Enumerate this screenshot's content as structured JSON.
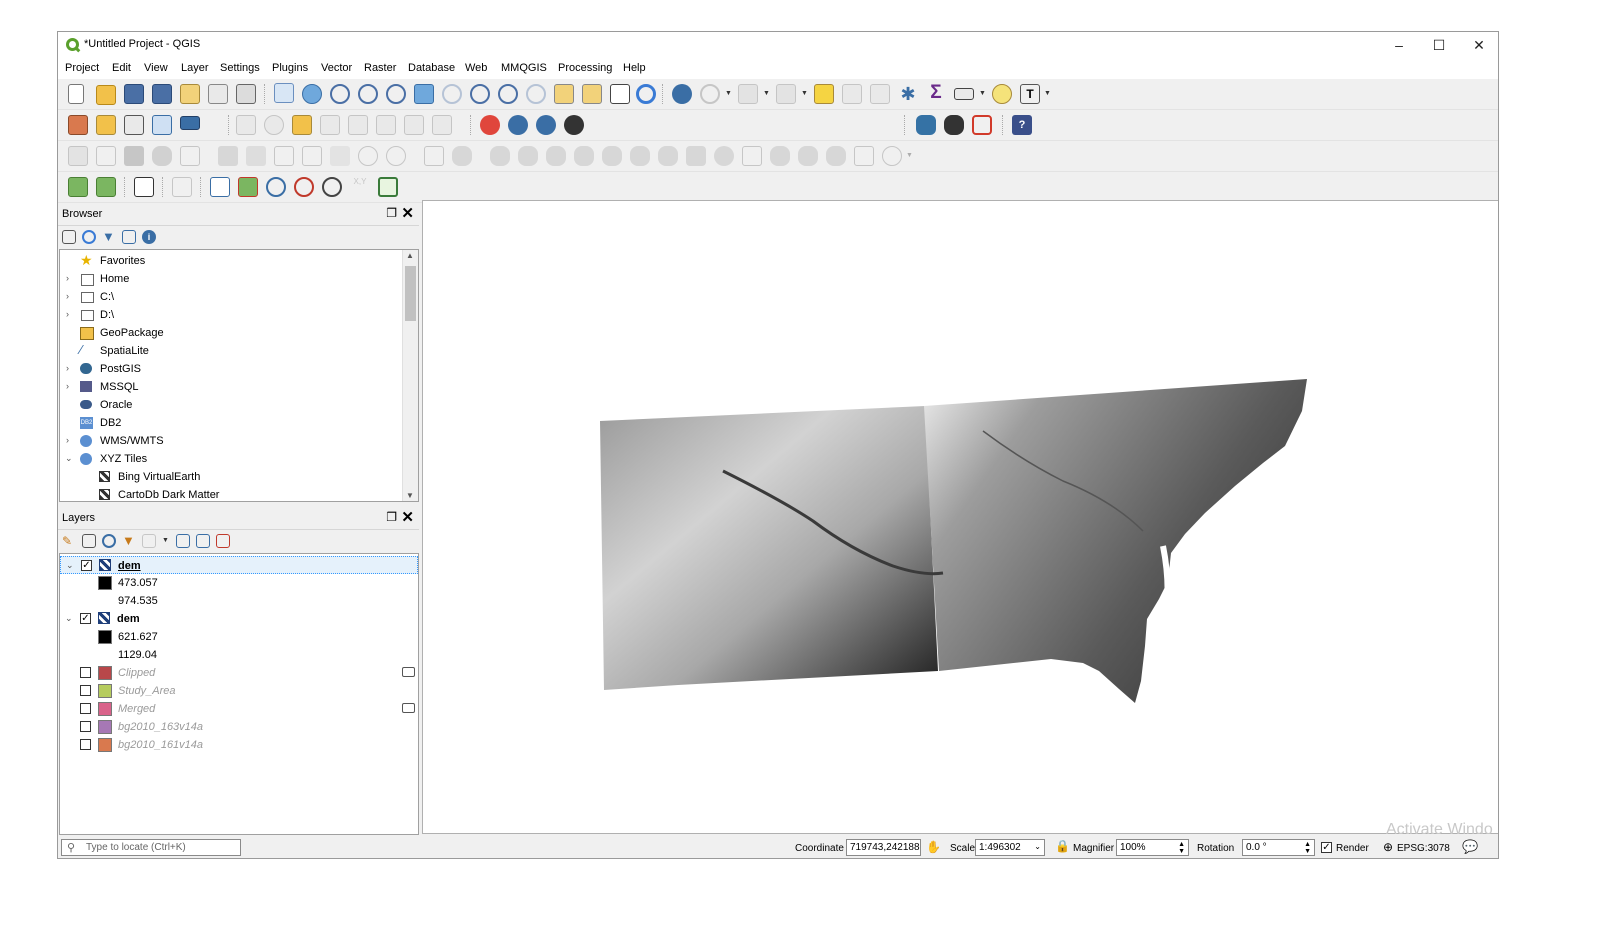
{
  "window": {
    "title": "*Untitled Project - QGIS",
    "controls": [
      "–",
      "☐",
      "✕"
    ]
  },
  "menu": [
    "Project",
    "Edit",
    "View",
    "Layer",
    "Settings",
    "Plugins",
    "Vector",
    "Raster",
    "Database",
    "Web",
    "MMQGIS",
    "Processing",
    "Help"
  ],
  "browser": {
    "title": "Browser",
    "items": [
      {
        "label": "Favorites",
        "icon": "star-icon"
      },
      {
        "label": "Home",
        "icon": "home-folder-icon"
      },
      {
        "label": "C:\\",
        "icon": "drive-icon"
      },
      {
        "label": "D:\\",
        "icon": "drive-icon"
      },
      {
        "label": "GeoPackage",
        "icon": "geopackage-icon"
      },
      {
        "label": "SpatiaLite",
        "icon": "spatialite-icon"
      },
      {
        "label": "PostGIS",
        "icon": "postgis-icon"
      },
      {
        "label": "MSSQL",
        "icon": "mssql-icon"
      },
      {
        "label": "Oracle",
        "icon": "oracle-icon"
      },
      {
        "label": "DB2",
        "icon": "db2-icon"
      },
      {
        "label": "WMS/WMTS",
        "icon": "globe-icon"
      },
      {
        "label": "XYZ Tiles",
        "icon": "globe-icon"
      },
      {
        "label": "Bing VirtualEarth",
        "icon": "xyz-tile-icon"
      },
      {
        "label": "CartoDb Dark Matter",
        "icon": "xyz-tile-icon"
      }
    ],
    "db2_badge": "DB2"
  },
  "layers": {
    "title": "Layers",
    "dem1": {
      "name": "dem",
      "min": "473.057",
      "max": "974.535"
    },
    "dem2": {
      "name": "dem",
      "min": "621.627",
      "max": "1129.04"
    },
    "vectors": [
      {
        "name": "Clipped",
        "color": "#b8474a"
      },
      {
        "name": "Study_Area",
        "color": "#b6cc5e"
      },
      {
        "name": "Merged",
        "color": "#d9628a"
      },
      {
        "name": "bg2010_163v14a",
        "color": "#a678b5"
      },
      {
        "name": "bg2010_161v14a",
        "color": "#d9794e"
      }
    ]
  },
  "status": {
    "locator_placeholder": "Type to locate (Ctrl+K)",
    "coordinate_label": "Coordinate",
    "coordinate_value": "719743,242188",
    "scale_label": "Scale",
    "scale_value": "1:496302",
    "magnifier_label": "Magnifier",
    "magnifier_value": "100%",
    "rotation_label": "Rotation",
    "rotation_value": "0.0 °",
    "render_label": "Render",
    "crs": "EPSG:3078"
  },
  "watermark": "Activate Windo",
  "colors": {
    "accent": "#3399ff",
    "qgis_green": "#5aa02c"
  }
}
